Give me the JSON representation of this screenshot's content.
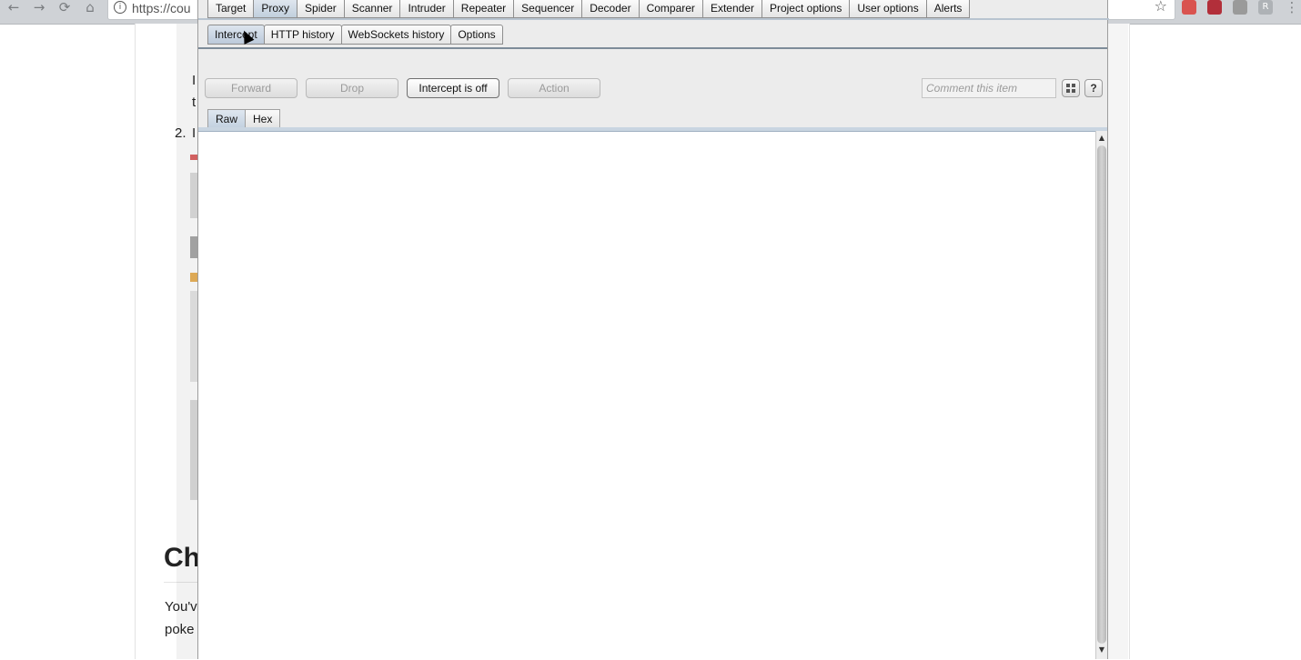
{
  "browser": {
    "url_text": "https://cou",
    "nav_back": "←",
    "nav_forward": "→",
    "nav_reload": "⟳",
    "nav_home": "⌂",
    "info_glyph": "i",
    "star_glyph": "☆",
    "menu_glyph": "⋮",
    "extensions": [
      {
        "icon": "shield-extension-icon",
        "color": "#d9534f"
      },
      {
        "icon": "mail-extension-icon",
        "color": "#b22f3a"
      },
      {
        "icon": "cloud-extension-icon",
        "color": "#9a9a9a"
      },
      {
        "icon": "r-extension-icon",
        "color": "#aeb2b6",
        "glyph": "R"
      }
    ]
  },
  "page": {
    "para_char_1": "I",
    "para_char_2": "t",
    "list_marker": "2.",
    "list_char": "I",
    "heading": "Ch",
    "body_line_1": "You'v",
    "body_line_2": "poke"
  },
  "burp": {
    "tabs": [
      "Target",
      "Proxy",
      "Spider",
      "Scanner",
      "Intruder",
      "Repeater",
      "Sequencer",
      "Decoder",
      "Comparer",
      "Extender",
      "Project options",
      "User options",
      "Alerts"
    ],
    "active_tab": "Proxy",
    "proxy_tabs": [
      "Intercept",
      "HTTP history",
      "WebSockets history",
      "Options"
    ],
    "active_proxy_tab": "Intercept",
    "toolbar": {
      "forward": "Forward",
      "drop": "Drop",
      "intercept": "Intercept is off",
      "action": "Action",
      "comment_placeholder": "Comment this item",
      "help": "?"
    },
    "view_tabs": [
      "Raw",
      "Hex"
    ],
    "active_view_tab": "Raw",
    "scroll_up": "▲",
    "scroll_down": "▼"
  },
  "colors": {
    "active_tab": "#c1cfdd",
    "window_bg": "#ececec",
    "editor_bg": "#ffffff"
  }
}
